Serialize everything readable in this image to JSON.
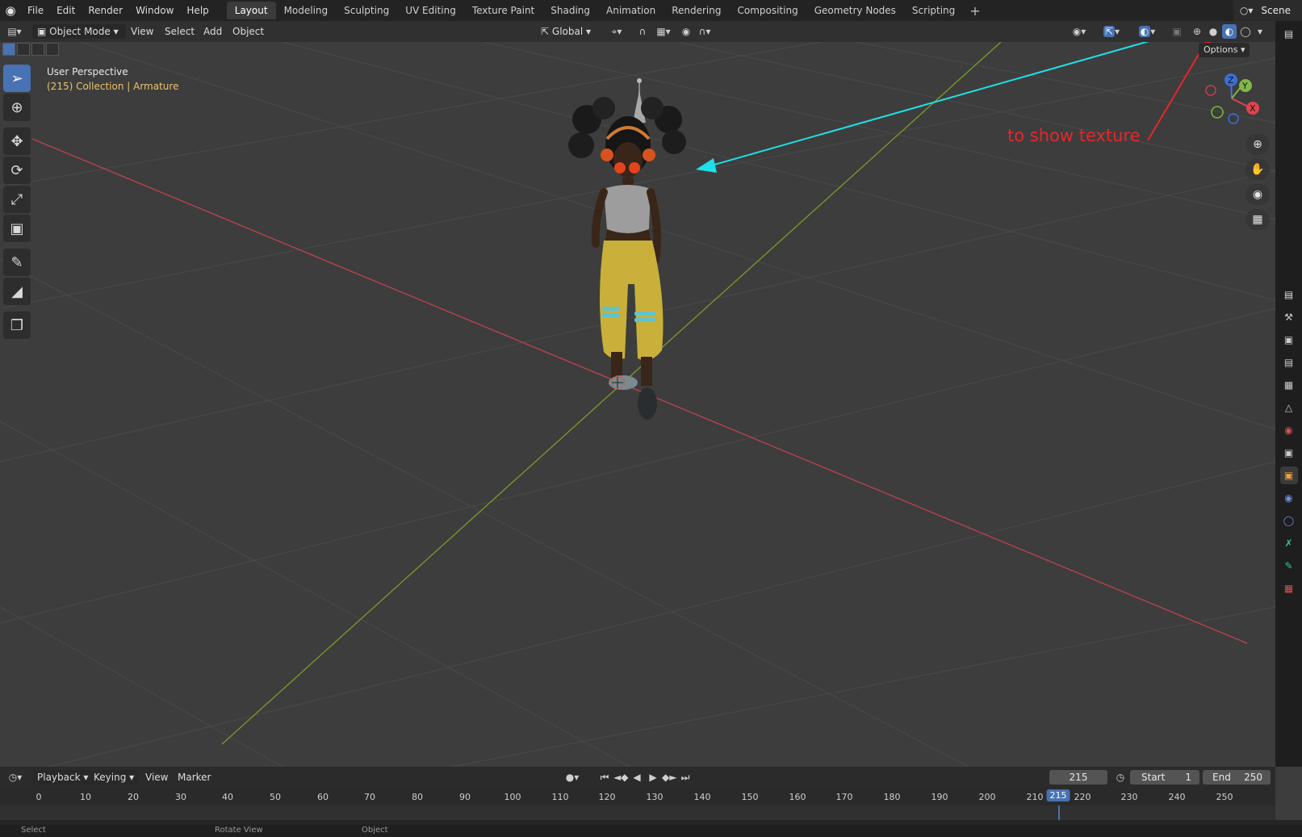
{
  "topbar": {
    "menu": [
      "File",
      "Edit",
      "Render",
      "Window",
      "Help"
    ],
    "workspaces": [
      "Layout",
      "Modeling",
      "Sculpting",
      "UV Editing",
      "Texture Paint",
      "Shading",
      "Animation",
      "Rendering",
      "Compositing",
      "Geometry Nodes",
      "Scripting"
    ],
    "active_workspace": "Layout",
    "scene": "Scene"
  },
  "header": {
    "mode": "Object Mode",
    "menu": [
      "View",
      "Select",
      "Add",
      "Object"
    ],
    "orientation": "Global",
    "options": "Options"
  },
  "viewport": {
    "title": "User Perspective",
    "collection_info": "(215) Collection | Armature",
    "annotation": "to show texture",
    "axes": {
      "x": "X",
      "y": "Y",
      "z": "Z"
    }
  },
  "timeline": {
    "menu": [
      "Playback",
      "Keying",
      "View",
      "Marker"
    ],
    "current_frame": "215",
    "start_label": "Start",
    "start_value": "1",
    "end_label": "End",
    "end_value": "250",
    "ruler": [
      "0",
      "10",
      "20",
      "30",
      "40",
      "50",
      "60",
      "70",
      "80",
      "90",
      "100",
      "110",
      "120",
      "130",
      "140",
      "150",
      "160",
      "170",
      "180",
      "190",
      "200",
      "210",
      "215",
      "220",
      "230",
      "240",
      "250"
    ]
  },
  "status": {
    "left": "Select",
    "mid": "Rotate View",
    "right": "Object"
  },
  "colors": {
    "accent": "#4772b3",
    "x_axis": "#c0424f",
    "y_axis": "#7a9c2c",
    "annotation_red": "#e6262a",
    "annotation_cyan": "#1ee0e8",
    "collection": "#e8c46a"
  }
}
